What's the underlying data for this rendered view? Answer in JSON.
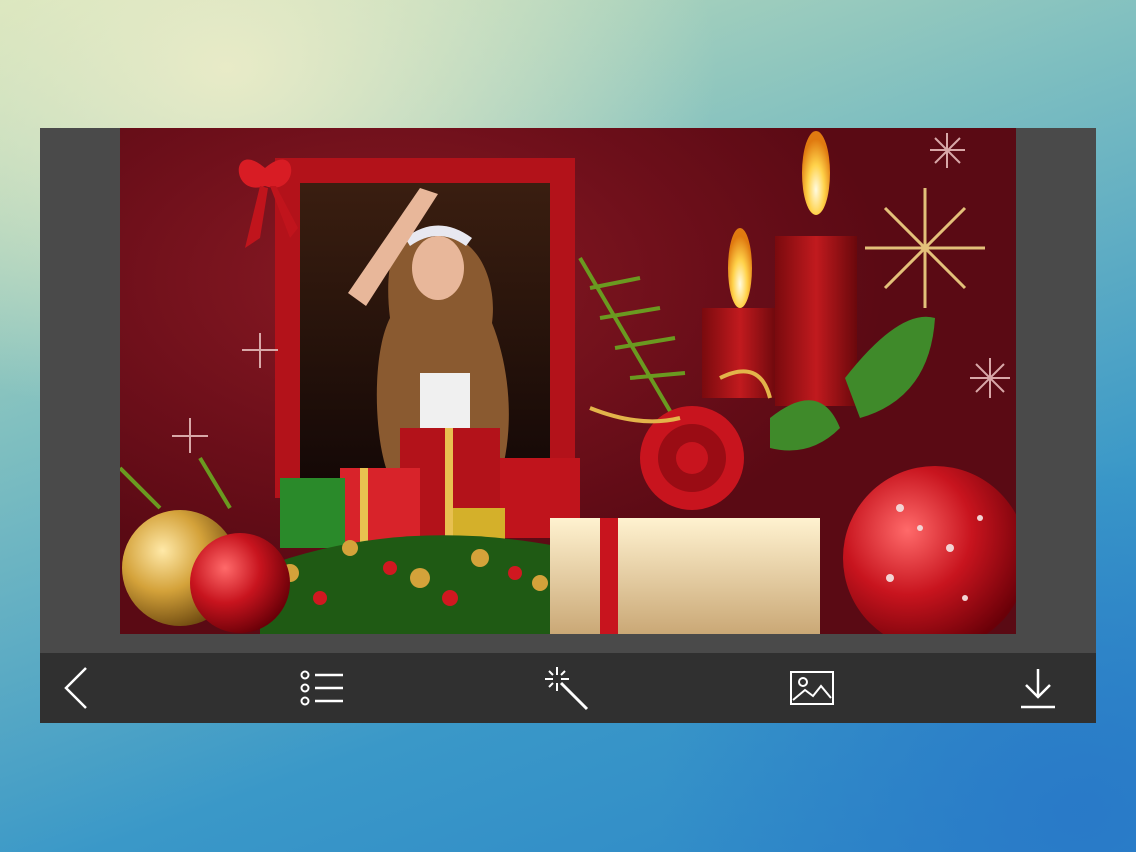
{
  "toolbar": {
    "items": [
      {
        "icon": "back-chevron-icon",
        "label": ""
      },
      {
        "icon": "list-icon",
        "label": ""
      },
      {
        "icon": "magic-wand-icon",
        "label": ""
      },
      {
        "icon": "image-icon",
        "label": ""
      },
      {
        "icon": "download-icon",
        "label": ""
      }
    ]
  },
  "colors": {
    "frame_bg": "#4a4a4a",
    "toolbar_bg": "#303030",
    "canvas_bg": "#6d0f1a",
    "icon": "#ffffff"
  }
}
